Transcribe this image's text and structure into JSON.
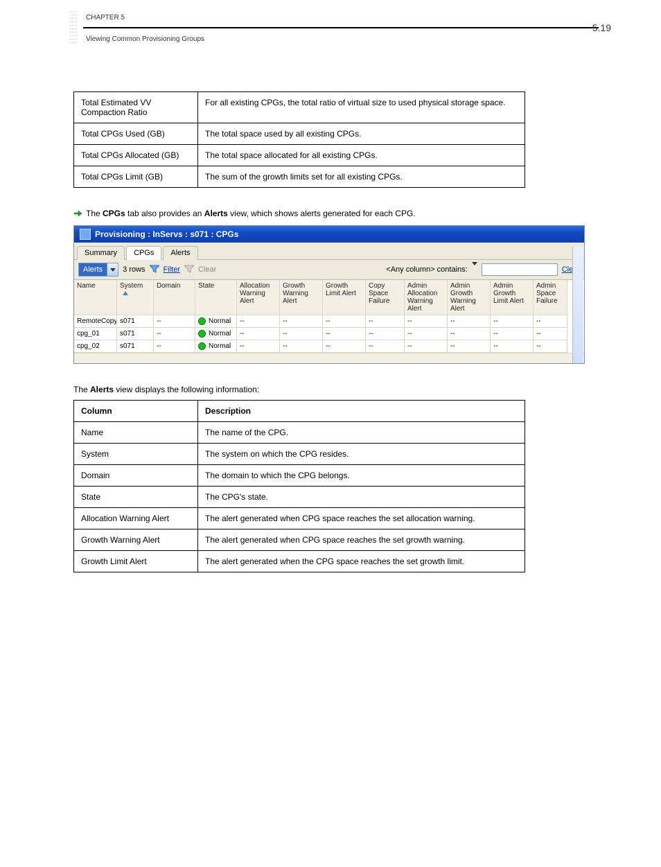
{
  "header": {
    "chapter": "CHAPTER 5",
    "section": "Viewing Common Provisioning Groups",
    "page": "5.19"
  },
  "table1": {
    "rows": [
      {
        "k": "Total Estimated VV Compaction Ratio",
        "v": "For all existing CPGs, the total ratio of virtual size to used physical storage space."
      },
      {
        "k": "Total CPGs Used (GB)",
        "v": "The total space used by all existing CPGs."
      },
      {
        "k": "Total CPGs Allocated (GB)",
        "v": "The total space allocated for all existing CPGs."
      },
      {
        "k": "Total CPGs Limit (GB)",
        "v": "The sum of the growth limits set for all existing CPGs."
      }
    ]
  },
  "tabs": {
    "items": [
      "Summary",
      "CPGs",
      "Alerts"
    ],
    "active": 1
  },
  "figure": {
    "intro_before": "The ",
    "intro_tab": "CPGs",
    "intro_after": " tab also provides an ",
    "intro_label": "Alerts",
    "intro_tail": " view, which shows alerts generated for each CPG.",
    "window_title": "Provisioning : InServs : s071 : CPGs",
    "dropdown_value": "Alerts",
    "rows_label": "3 rows",
    "filter_label": "Filter",
    "clear_filter_label": "Clear",
    "any_column": "<Any column> contains:",
    "clear_link": "Clear",
    "filter_value": "",
    "columns": [
      "Name",
      "System",
      "Domain",
      "State",
      "Allocation Warning Alert",
      "Growth Warning Alert",
      "Growth Limit Alert",
      "Copy Space Failure",
      "Admin Allocation Warning Alert",
      "Admin Growth Warning Alert",
      "Admin Growth Limit Alert",
      "Admin Space Failure"
    ],
    "sort_column_index": 1,
    "grid_rows": [
      {
        "name": "RemoteCopy",
        "system": "s071",
        "domain": "--",
        "state": "Normal",
        "c4": "--",
        "c5": "--",
        "c6": "--",
        "c7": "--",
        "c8": "--",
        "c9": "--",
        "c10": "--",
        "c11": "--"
      },
      {
        "name": "cpg_01",
        "system": "s071",
        "domain": "--",
        "state": "Normal",
        "c4": "--",
        "c5": "--",
        "c6": "--",
        "c7": "--",
        "c8": "--",
        "c9": "--",
        "c10": "--",
        "c11": "--"
      },
      {
        "name": "cpg_02",
        "system": "s071",
        "domain": "--",
        "state": "Normal",
        "c4": "--",
        "c5": "--",
        "c6": "--",
        "c7": "--",
        "c8": "--",
        "c9": "--",
        "c10": "--",
        "c11": "--"
      }
    ]
  },
  "caption2": {
    "before": "The ",
    "word": "Alerts",
    "after": " view displays the following information:"
  },
  "table2": {
    "head": {
      "k": "Column",
      "v": "Description"
    },
    "rows": [
      {
        "k": "Name",
        "v": "The name of the CPG."
      },
      {
        "k": "System",
        "v": "The system on which the CPG resides."
      },
      {
        "k": "Domain",
        "v": "The domain to which the CPG belongs."
      },
      {
        "k": "State",
        "v": "The CPG's state."
      },
      {
        "k": "Allocation Warning Alert",
        "v": "The alert generated when CPG space reaches the set allocation warning."
      },
      {
        "k": "Growth Warning Alert",
        "v": "The alert generated when CPG space reaches the set growth warning."
      },
      {
        "k": "Growth Limit Alert",
        "v": "The alert generated when the CPG space reaches the set growth limit."
      }
    ]
  }
}
